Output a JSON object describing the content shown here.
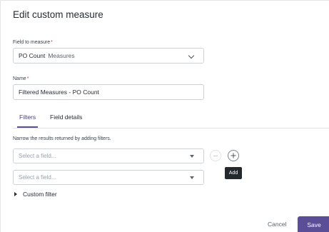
{
  "dialog": {
    "title": "Edit custom measure"
  },
  "field_to_measure": {
    "label": "Field to measure",
    "required_mark": "*",
    "value": "PO Count",
    "sub_value": "Measures"
  },
  "name": {
    "label": "Name",
    "required_mark": "*",
    "value": "Filtered Measures - PO Count"
  },
  "tabs": [
    {
      "label": "Filters",
      "active": true
    },
    {
      "label": "Field details",
      "active": false
    }
  ],
  "filters": {
    "hint": "Narrow the results returned by adding filters.",
    "rows": [
      {
        "placeholder": "Select a field..."
      },
      {
        "placeholder": "Select a field..."
      }
    ],
    "add_tooltip": "Add",
    "custom_filter_label": "Custom filter"
  },
  "footer": {
    "cancel_label": "Cancel",
    "save_label": "Save"
  },
  "colors": {
    "accent": "#5b4d96",
    "required": "#c63d3d",
    "tooltip_bg": "#24292e"
  }
}
